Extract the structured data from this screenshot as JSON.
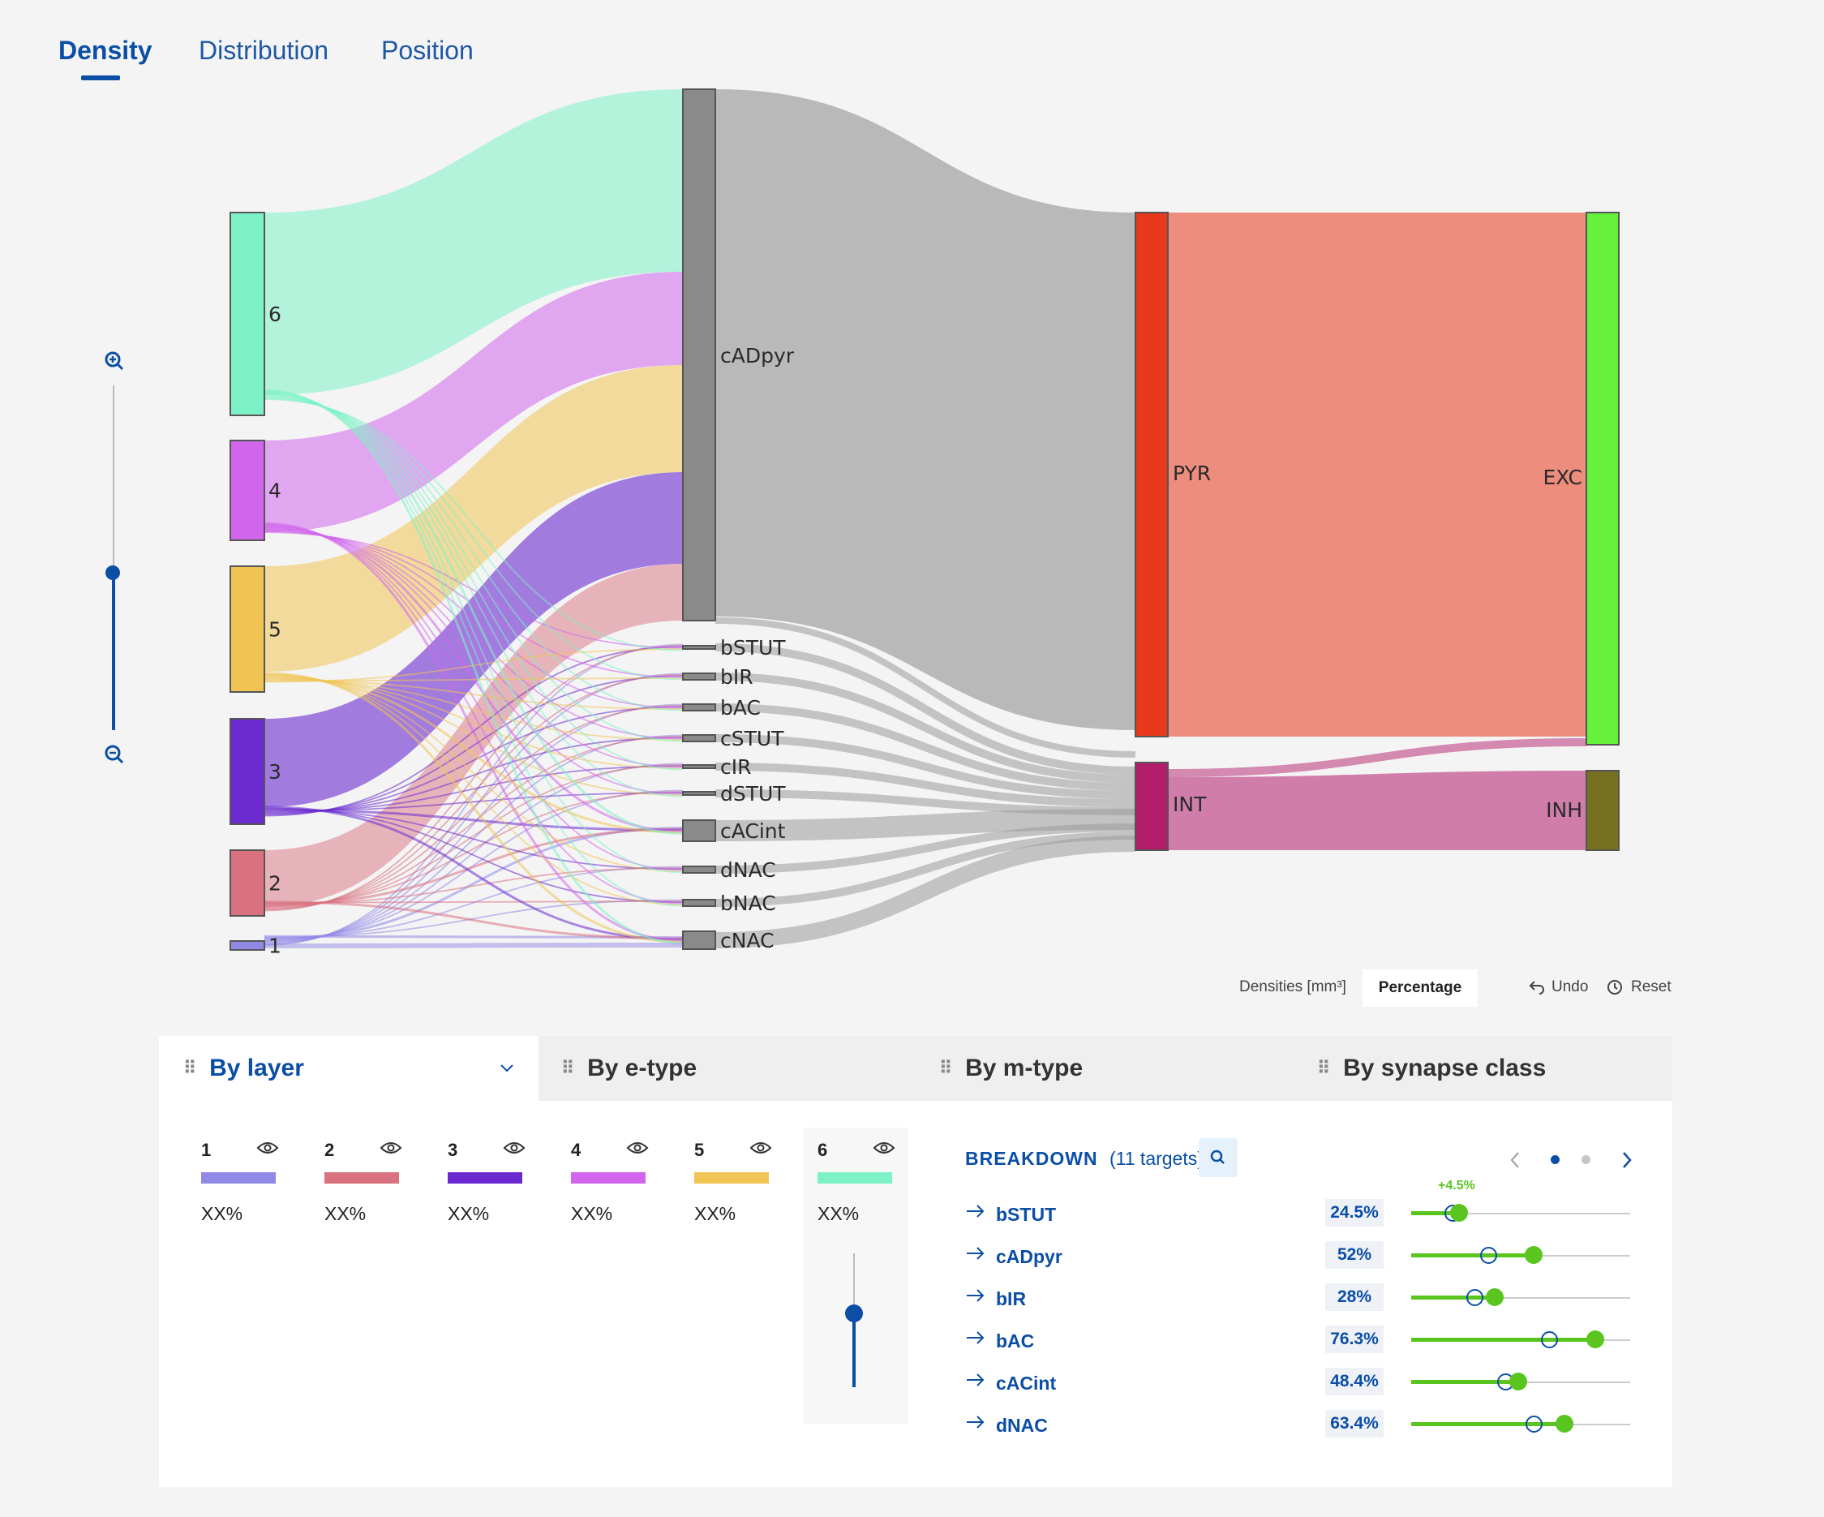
{
  "tabs": [
    {
      "label": "Density",
      "active": true
    },
    {
      "label": "Distribution",
      "active": false
    },
    {
      "label": "Position",
      "active": false
    }
  ],
  "sankey": {
    "layers": [
      {
        "id": "6",
        "label": "6",
        "color": "#7ef2c7"
      },
      {
        "id": "4",
        "label": "4",
        "color": "#d166ec"
      },
      {
        "id": "5",
        "label": "5",
        "color": "#f0c453"
      },
      {
        "id": "3",
        "label": "3",
        "color": "#6a2ad0"
      },
      {
        "id": "2",
        "label": "2",
        "color": "#d9717f"
      },
      {
        "id": "1",
        "label": "1",
        "color": "#9189e6"
      }
    ],
    "etypes": [
      "cADpyr",
      "bSTUT",
      "bIR",
      "bAC",
      "cSTUT",
      "cIR",
      "dSTUT",
      "cACint",
      "dNAC",
      "bNAC",
      "cNAC"
    ],
    "mtypes": [
      {
        "label": "PYR",
        "color": "#e8391c"
      },
      {
        "label": "INT",
        "color": "#b21d6c"
      }
    ],
    "classes": [
      {
        "label": "EXC",
        "color": "#66f23a"
      },
      {
        "label": "INH",
        "color": "#777020"
      }
    ]
  },
  "controls": {
    "densities_label": "Densities [mm³]",
    "percentage_label": "Percentage",
    "undo_label": "Undo",
    "reset_label": "Reset"
  },
  "panel": {
    "tabs": [
      "By layer",
      "By e-type",
      "By m-type",
      "By synapse class"
    ],
    "layers": [
      {
        "num": "1",
        "value": "XX%",
        "color": "#9189e6"
      },
      {
        "num": "2",
        "value": "XX%",
        "color": "#d9717f"
      },
      {
        "num": "3",
        "value": "XX%",
        "color": "#6a2ad0"
      },
      {
        "num": "4",
        "value": "XX%",
        "color": "#d166ec"
      },
      {
        "num": "5",
        "value": "XX%",
        "color": "#f0c453"
      },
      {
        "num": "6",
        "value": "XX%",
        "color": "#7ef2c7"
      }
    ],
    "layer6_slider_level": 0.55,
    "breakdown": {
      "title": "BREAKDOWN",
      "targets": "(11 targets)",
      "delta_label": "+4.5%",
      "rows": [
        {
          "name": "bSTUT",
          "value": "24.5%",
          "level": 0.22,
          "original": 0.19
        },
        {
          "name": "cADpyr",
          "value": "52%",
          "level": 0.56,
          "original": 0.35
        },
        {
          "name": "bIR",
          "value": "28%",
          "level": 0.38,
          "original": 0.29
        },
        {
          "name": "bAC",
          "value": "76.3%",
          "level": 0.84,
          "original": 0.63
        },
        {
          "name": "cACint",
          "value": "48.4%",
          "level": 0.49,
          "original": 0.43
        },
        {
          "name": "dNAC",
          "value": "63.4%",
          "level": 0.7,
          "original": 0.56
        }
      ]
    }
  }
}
